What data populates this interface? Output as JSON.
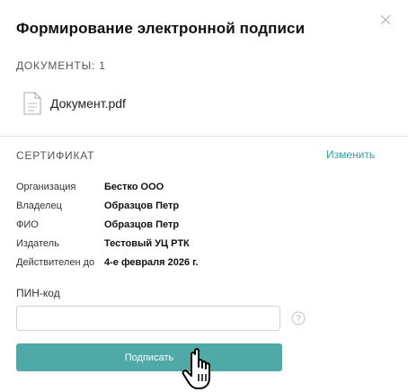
{
  "dialog": {
    "title": "Формирование электронной подписи",
    "close_icon": "close-icon"
  },
  "documents": {
    "label": "ДОКУМЕНТЫ: 1",
    "items": [
      {
        "name": "Документ.pdf",
        "icon": "file-icon"
      }
    ]
  },
  "certificate": {
    "label": "СЕРТИФИКАТ",
    "change_link": "Изменить",
    "fields": [
      {
        "key": "Организация",
        "value": "Бестко ООО"
      },
      {
        "key": "Владелец",
        "value": "Образцов Петр"
      },
      {
        "key": "ФИО",
        "value": "Образцов Петр"
      },
      {
        "key": "Издатель",
        "value": "Тестовый УЦ РТК"
      },
      {
        "key": "Действителен до",
        "value": "4-е февраля 2026 г."
      }
    ]
  },
  "pin": {
    "label": "ПИН-код",
    "value": "",
    "placeholder": "",
    "help_icon": "question-icon"
  },
  "actions": {
    "sign_label": "Подписать"
  },
  "colors": {
    "accent": "#4faaa7",
    "link": "#3a9d9b",
    "divider": "#e6e6e6"
  },
  "cursor": "hand-pointer-icon"
}
